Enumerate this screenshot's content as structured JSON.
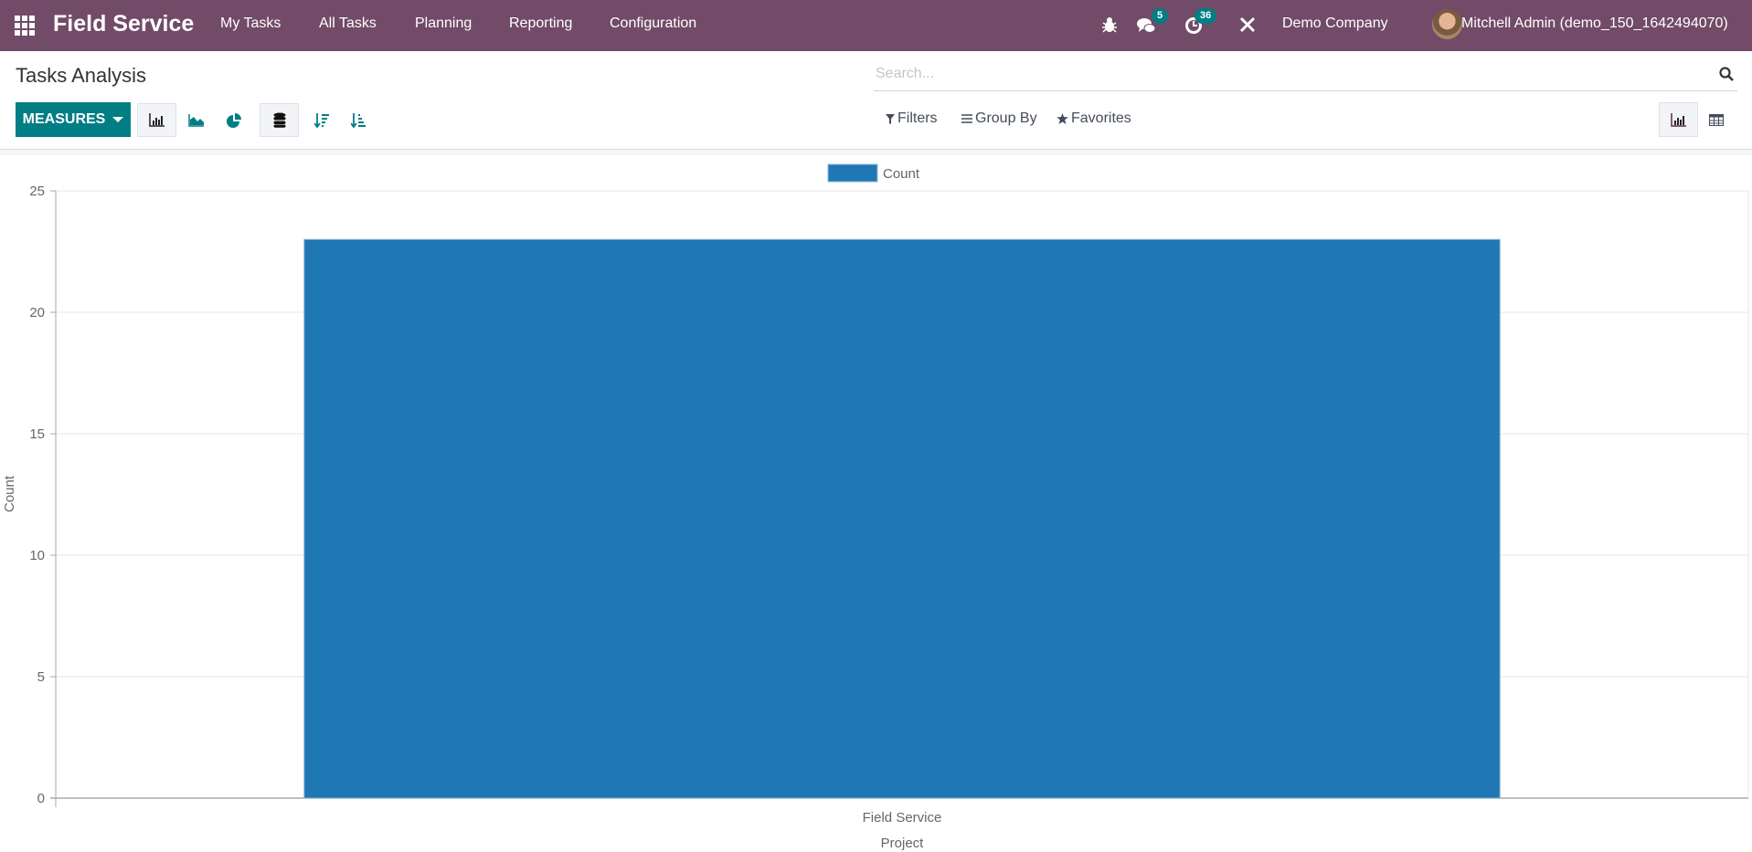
{
  "navbar": {
    "app_name": "Field Service",
    "menu": [
      "My Tasks",
      "All Tasks",
      "Planning",
      "Reporting",
      "Configuration"
    ],
    "messages_badge": "5",
    "activities_badge": "36",
    "company": "Demo Company",
    "user": "Mitchell Admin (demo_150_1642494070)",
    "icons": [
      "apps-grid-icon",
      "bug-icon",
      "chat-icon",
      "clock-icon",
      "tools-icon"
    ],
    "bg_color": "#714B67"
  },
  "page": {
    "title": "Tasks Analysis",
    "search_placeholder": "Search...",
    "measures_label": "MEASURES",
    "filters_label": "Filters",
    "groupby_label": "Group By",
    "favorites_label": "Favorites",
    "accent_color": "#017E84"
  },
  "chart_data": {
    "type": "bar",
    "title": "",
    "categories": [
      "Field Service"
    ],
    "series": [
      {
        "name": "Count",
        "values": [
          23
        ],
        "color": "#1f77b4"
      }
    ],
    "xlabel": "Project",
    "ylabel": "Count",
    "ylim": [
      0,
      25
    ],
    "yticks": [
      0,
      5,
      10,
      15,
      20,
      25
    ],
    "grid": true,
    "legend": "top-center"
  }
}
